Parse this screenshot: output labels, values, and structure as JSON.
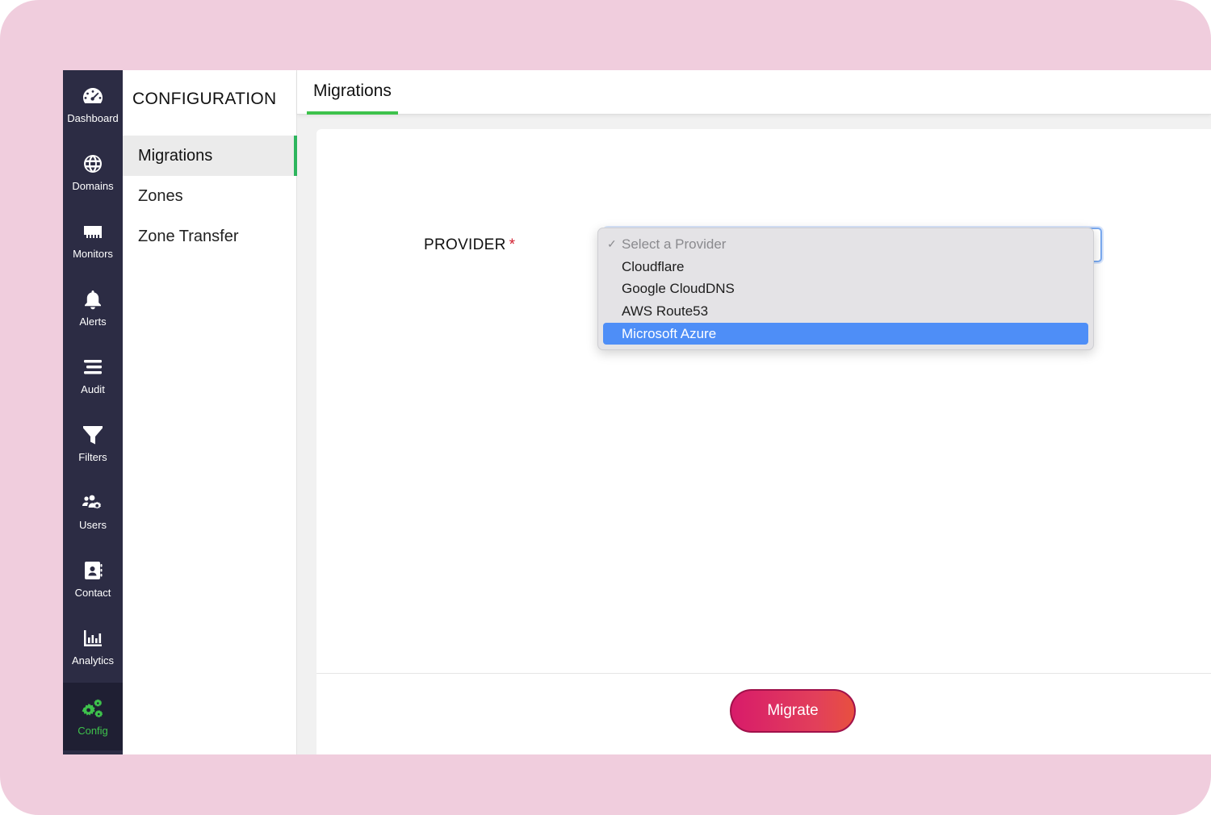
{
  "rail": {
    "items": [
      {
        "label": "Dashboard",
        "icon": "dashboard-icon"
      },
      {
        "label": "Domains",
        "icon": "globe-icon"
      },
      {
        "label": "Monitors",
        "icon": "monitor-icon"
      },
      {
        "label": "Alerts",
        "icon": "bell-icon"
      },
      {
        "label": "Audit",
        "icon": "audit-list-icon"
      },
      {
        "label": "Filters",
        "icon": "funnel-icon"
      },
      {
        "label": "Users",
        "icon": "users-gear-icon"
      },
      {
        "label": "Contact",
        "icon": "contact-book-icon"
      },
      {
        "label": "Analytics",
        "icon": "bar-chart-icon"
      },
      {
        "label": "Config",
        "icon": "gears-icon",
        "active": true
      }
    ]
  },
  "config": {
    "title": "CONFIGURATION",
    "items": [
      {
        "label": "Migrations",
        "active": true
      },
      {
        "label": "Zones"
      },
      {
        "label": "Zone Transfer"
      }
    ]
  },
  "main": {
    "tab": "Migrations",
    "form": {
      "provider_label": "PROVIDER",
      "required_mark": "*",
      "options": [
        {
          "label": "Select a Provider",
          "placeholder": true,
          "checked": true
        },
        {
          "label": "Cloudflare"
        },
        {
          "label": "Google CloudDNS"
        },
        {
          "label": "AWS Route53"
        },
        {
          "label": "Microsoft Azure",
          "highlighted": true
        }
      ]
    },
    "migrate_label": "Migrate"
  },
  "colors": {
    "frame": "#f0cddd",
    "rail": "#2c2c44",
    "accent_green": "#3ec24c",
    "highlight_blue": "#4e8ef7",
    "button_start": "#d81b6a",
    "button_end": "#e8503f"
  }
}
